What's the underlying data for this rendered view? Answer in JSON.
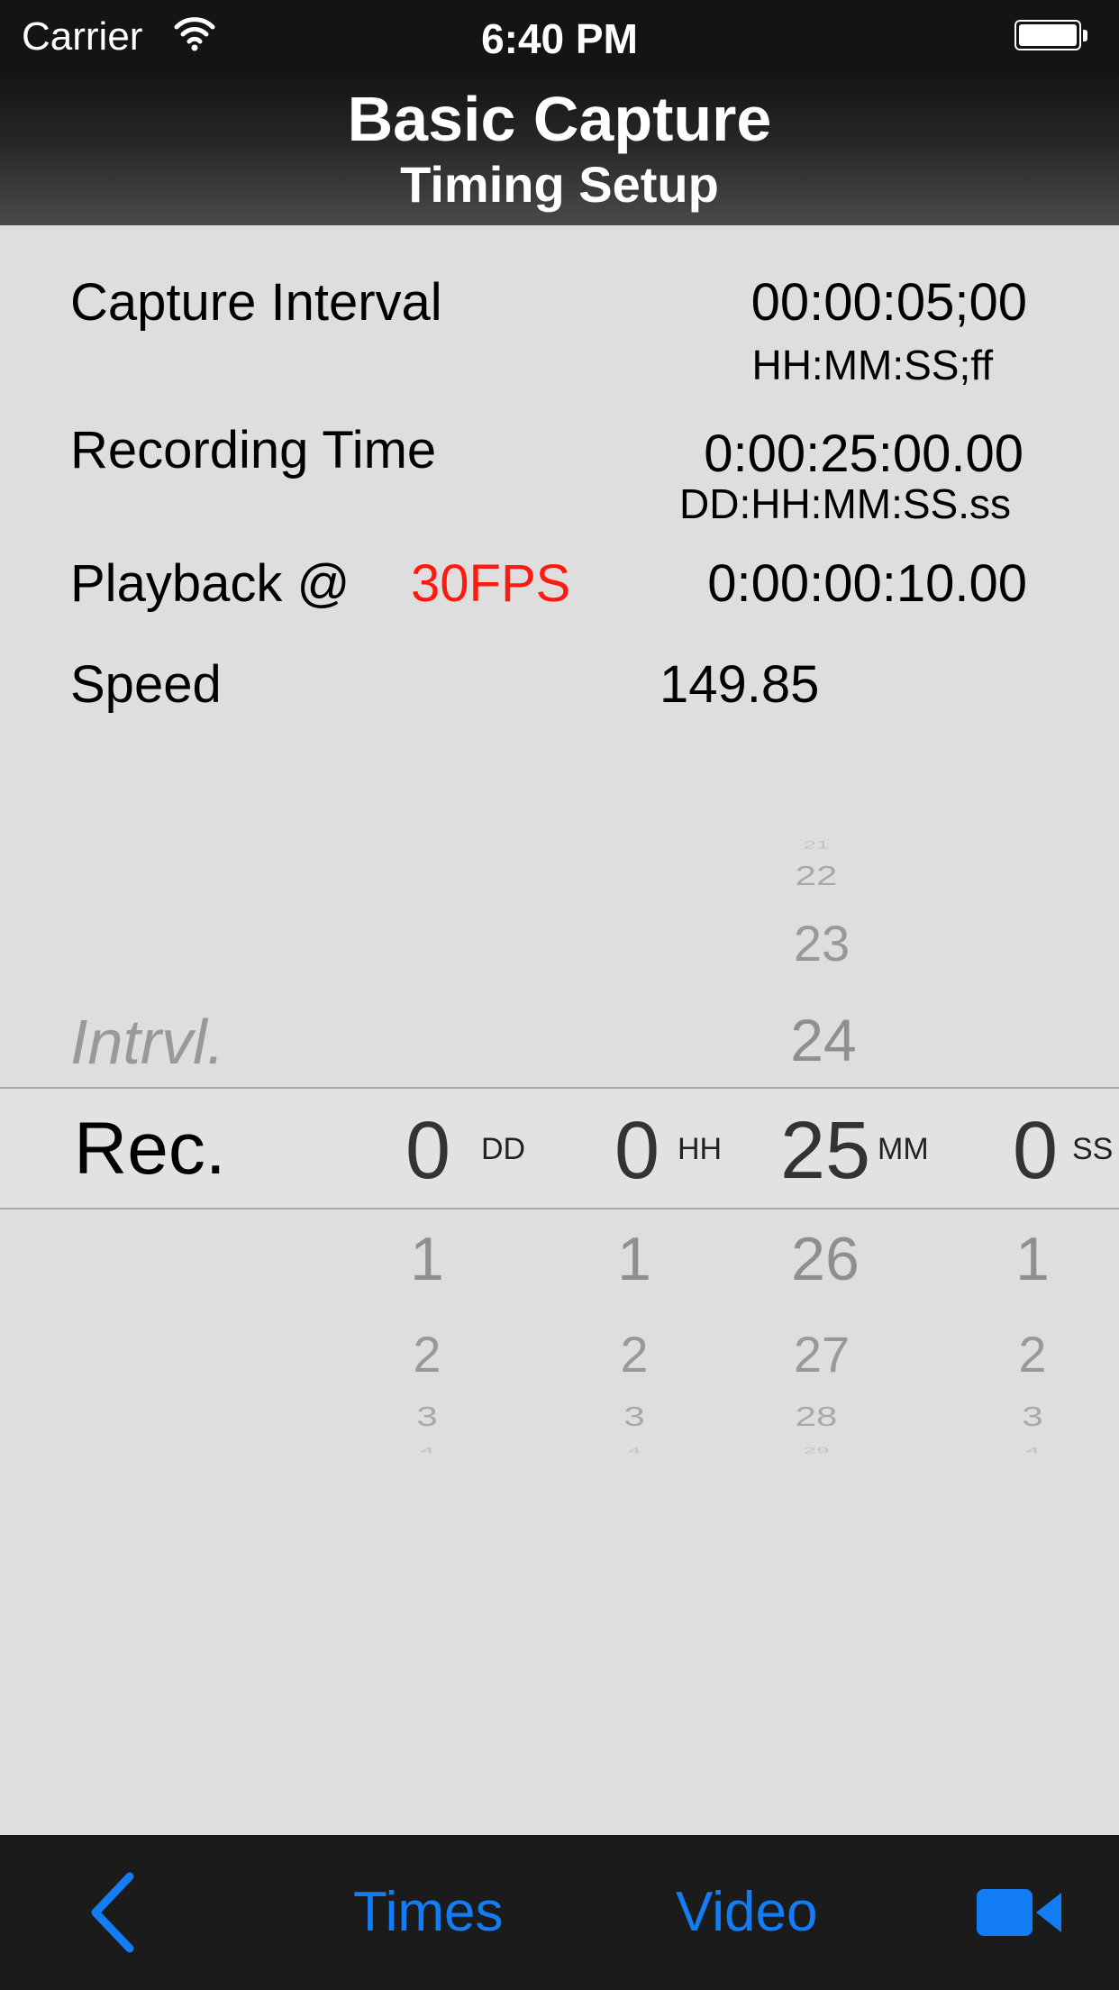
{
  "status_bar": {
    "carrier": "Carrier",
    "time": "6:40 PM"
  },
  "nav": {
    "title": "Basic Capture",
    "subtitle": "Timing Setup"
  },
  "settings": {
    "capture_interval": {
      "label": "Capture Interval",
      "value": "00:00:05;00",
      "format": "HH:MM:SS;ff"
    },
    "recording_time": {
      "label": "Recording Time",
      "value": "0:00:25:00.00",
      "format": "DD:HH:MM:SS.ss"
    },
    "playback": {
      "label": "Playback @",
      "fps": "30FPS",
      "value": "0:00:00:10.00"
    },
    "speed": {
      "label": "Speed",
      "value": "149.85"
    }
  },
  "picker": {
    "row_above": "Intrvl.",
    "row_selected": "Rec.",
    "minutes_above": [
      "21",
      "22",
      "23",
      "24"
    ],
    "columns": {
      "days": {
        "value": "0",
        "unit": "DD"
      },
      "hours": {
        "value": "0",
        "unit": "HH"
      },
      "minutes": {
        "value": "25",
        "unit": "MM"
      },
      "seconds": {
        "value": "0",
        "unit": "SS"
      }
    },
    "days_below": [
      "1",
      "2",
      "3",
      "4"
    ],
    "hours_below": [
      "1",
      "2",
      "3",
      "4"
    ],
    "minutes_below": [
      "26",
      "27",
      "28",
      "29"
    ],
    "seconds_below": [
      "1",
      "2",
      "3",
      "4"
    ]
  },
  "tab_bar": {
    "times": "Times",
    "video": "Video"
  },
  "colors": {
    "accent": "#137df6",
    "fps_red": "#ff1a10",
    "bar_dark": "#1b1b1b",
    "background": "#dedede"
  }
}
